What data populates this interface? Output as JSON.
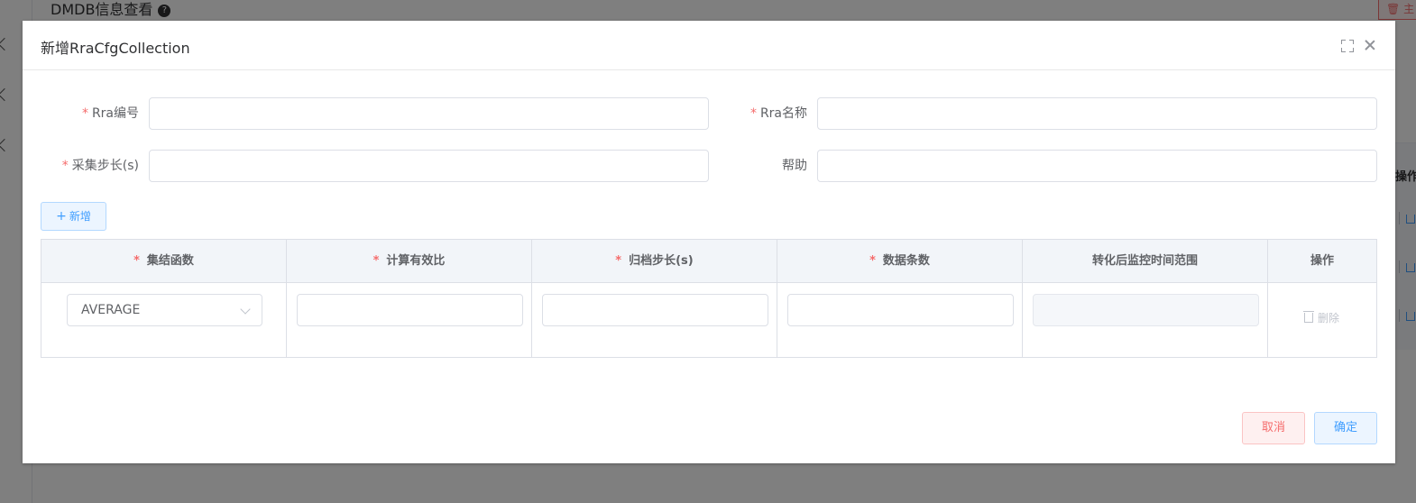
{
  "background": {
    "page_title": "DMDB信息查看",
    "help_icon": "question-circle-icon",
    "right_button_label": "主",
    "right_column_header": "操作"
  },
  "dialog": {
    "title": "新增RraCfgCollection",
    "fullscreen_icon": "fullscreen-icon",
    "close_icon": "close-icon"
  },
  "form": {
    "rra_code_label": "Rra编号",
    "rra_name_label": "Rra名称",
    "step_label": "采集步长(s)",
    "help_label": "帮助",
    "rra_code_value": "",
    "rra_name_value": "",
    "step_value": "",
    "help_value": ""
  },
  "add_button_label": "新增",
  "table": {
    "columns": [
      {
        "label": "集结函数",
        "required": true
      },
      {
        "label": "计算有效比",
        "required": true
      },
      {
        "label": "归档步长(s)",
        "required": true
      },
      {
        "label": "数据条数",
        "required": true
      },
      {
        "label": "转化后监控时间范围",
        "required": false
      },
      {
        "label": "操作",
        "required": false
      }
    ],
    "rows": [
      {
        "function": "AVERAGE",
        "valid_ratio": "",
        "archive_step": "",
        "data_count": "",
        "time_range": "",
        "delete_label": "删除"
      }
    ]
  },
  "footer": {
    "cancel_label": "取消",
    "confirm_label": "确定"
  },
  "colors": {
    "primary": "#409eff",
    "danger": "#f56c6c",
    "required_mark": "#f56c6c",
    "header_bg": "#f2f5f9"
  }
}
